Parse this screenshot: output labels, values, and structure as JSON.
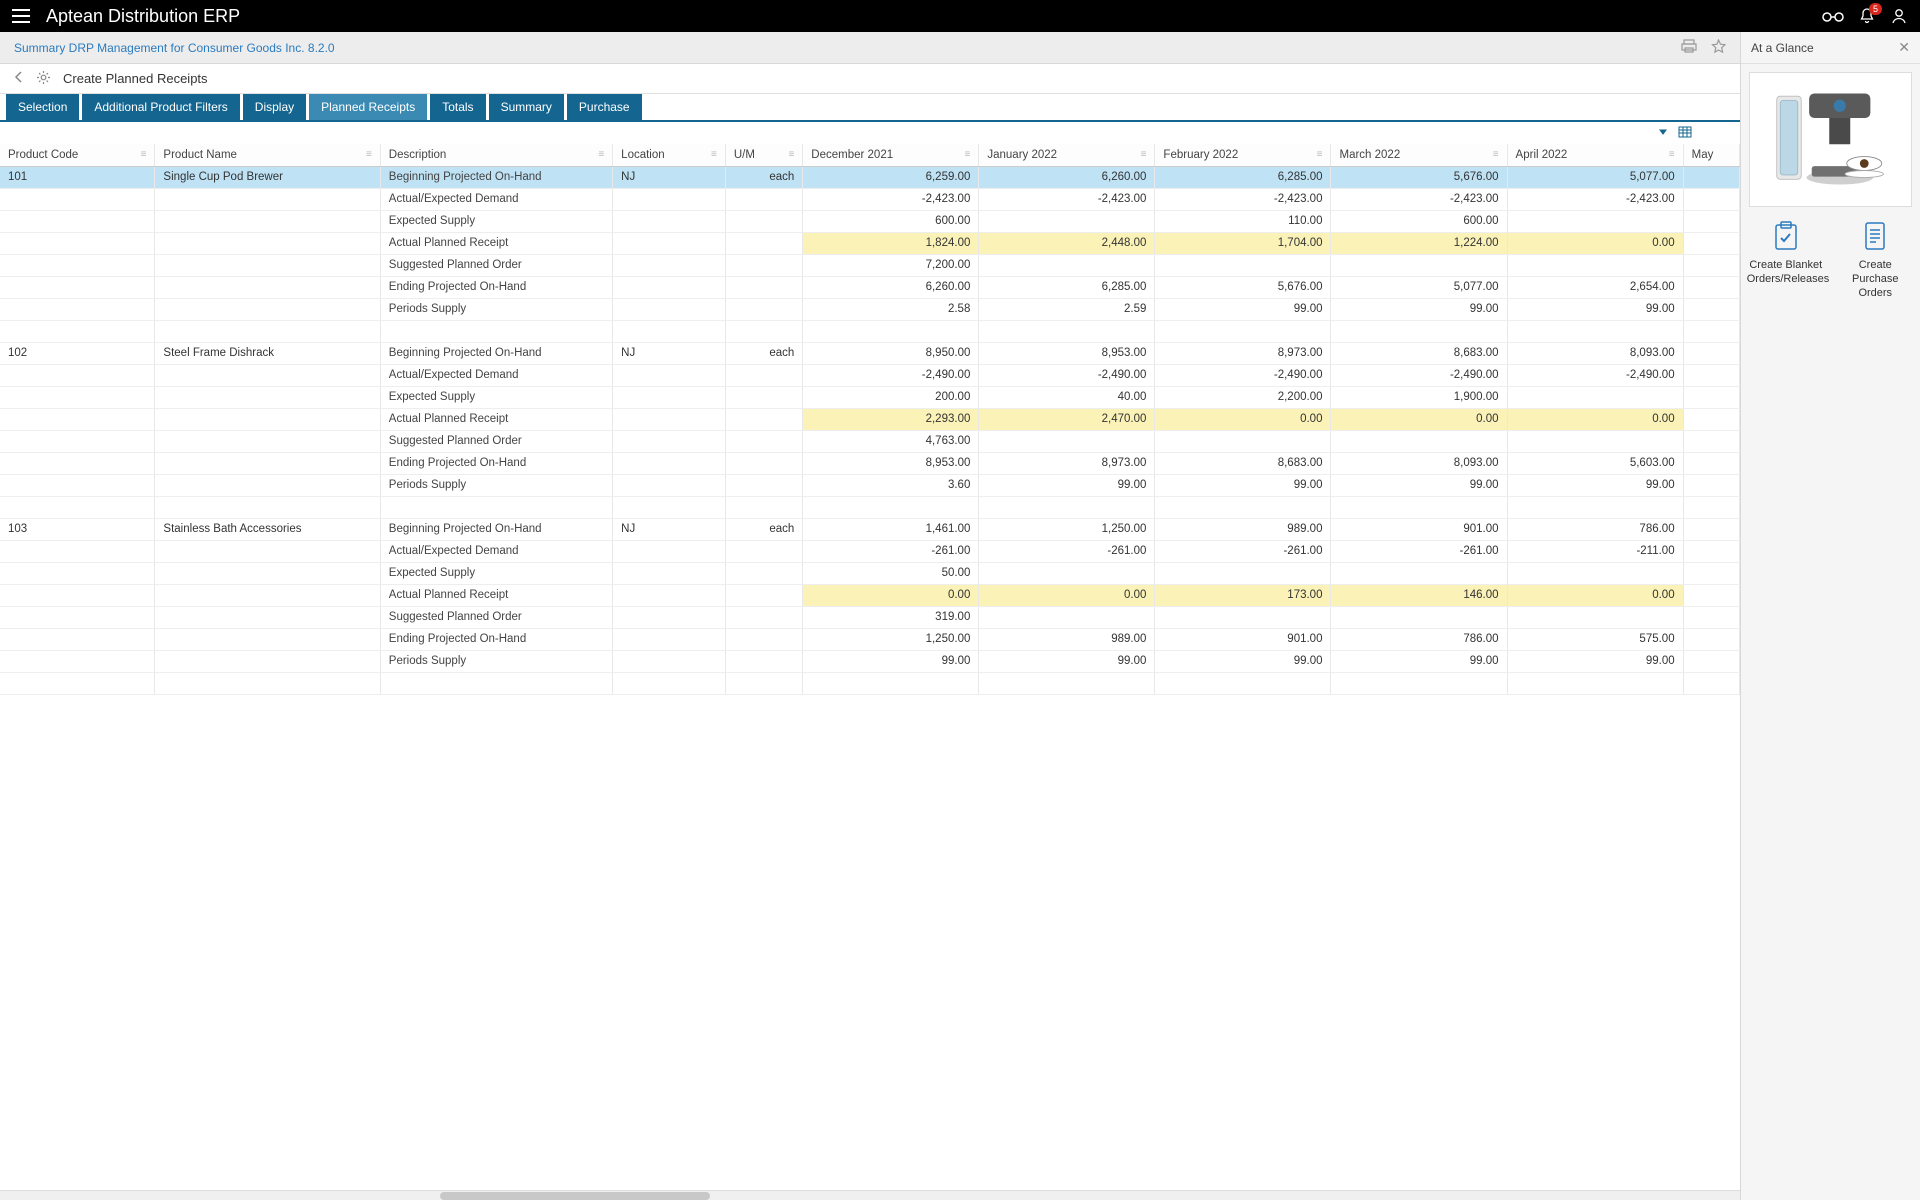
{
  "app": {
    "brand": "Aptean Distribution ERP"
  },
  "notifications": {
    "count": "5"
  },
  "breadcrumb": "Summary DRP Management for Consumer Goods Inc. 8.2.0",
  "page_title": "Create Planned Receipts",
  "tabs": [
    "Selection",
    "Additional Product Filters",
    "Display",
    "Planned Receipts",
    "Totals",
    "Summary",
    "Purchase"
  ],
  "active_tab_index": 3,
  "glance": {
    "title": "At a Glance",
    "actions": [
      {
        "label": "Create Blanket Orders/Releases"
      },
      {
        "label": "Create Purchase Orders"
      }
    ]
  },
  "columns": {
    "code": "Product Code",
    "name": "Product Name",
    "desc": "Description",
    "loc": "Location",
    "um": "U/M",
    "months": [
      "December 2021",
      "January 2022",
      "February 2022",
      "March 2022",
      "April 2022"
    ],
    "may_stub": "May"
  },
  "row_labels": {
    "bpo": "Beginning Projected On-Hand",
    "aed": "Actual/Expected Demand",
    "es": "Expected Supply",
    "apr": "Actual Planned Receipt",
    "spo": "Suggested Planned Order",
    "epo": "Ending Projected On-Hand",
    "ps": "Periods Supply"
  },
  "products": [
    {
      "code": "101",
      "name": "Single Cup Pod Brewer",
      "loc": "NJ",
      "um": "each",
      "rows": {
        "bpo": [
          "6,259.00",
          "6,260.00",
          "6,285.00",
          "5,676.00",
          "5,077.00"
        ],
        "aed": [
          "-2,423.00",
          "-2,423.00",
          "-2,423.00",
          "-2,423.00",
          "-2,423.00"
        ],
        "es": [
          "600.00",
          "",
          "110.00",
          "600.00",
          ""
        ],
        "apr": [
          "1,824.00",
          "2,448.00",
          "1,704.00",
          "1,224.00",
          "0.00"
        ],
        "spo": [
          "7,200.00",
          "",
          "",
          "",
          ""
        ],
        "epo": [
          "6,260.00",
          "6,285.00",
          "5,676.00",
          "5,077.00",
          "2,654.00"
        ],
        "ps": [
          "2.58",
          "2.59",
          "99.00",
          "99.00",
          "99.00"
        ]
      }
    },
    {
      "code": "102",
      "name": "Steel Frame Dishrack",
      "loc": "NJ",
      "um": "each",
      "rows": {
        "bpo": [
          "8,950.00",
          "8,953.00",
          "8,973.00",
          "8,683.00",
          "8,093.00"
        ],
        "aed": [
          "-2,490.00",
          "-2,490.00",
          "-2,490.00",
          "-2,490.00",
          "-2,490.00"
        ],
        "es": [
          "200.00",
          "40.00",
          "2,200.00",
          "1,900.00",
          ""
        ],
        "apr": [
          "2,293.00",
          "2,470.00",
          "0.00",
          "0.00",
          "0.00"
        ],
        "spo": [
          "4,763.00",
          "",
          "",
          "",
          ""
        ],
        "epo": [
          "8,953.00",
          "8,973.00",
          "8,683.00",
          "8,093.00",
          "5,603.00"
        ],
        "ps": [
          "3.60",
          "99.00",
          "99.00",
          "99.00",
          "99.00"
        ]
      }
    },
    {
      "code": "103",
      "name": "Stainless Bath Accessories",
      "loc": "NJ",
      "um": "each",
      "rows": {
        "bpo": [
          "1,461.00",
          "1,250.00",
          "989.00",
          "901.00",
          "786.00"
        ],
        "aed": [
          "-261.00",
          "-261.00",
          "-261.00",
          "-261.00",
          "-211.00"
        ],
        "es": [
          "50.00",
          "",
          "",
          "",
          ""
        ],
        "apr": [
          "0.00",
          "0.00",
          "173.00",
          "146.00",
          "0.00"
        ],
        "spo": [
          "319.00",
          "",
          "",
          "",
          ""
        ],
        "epo": [
          "1,250.00",
          "989.00",
          "901.00",
          "786.00",
          "575.00"
        ],
        "ps": [
          "99.00",
          "99.00",
          "99.00",
          "99.00",
          "99.00"
        ]
      }
    }
  ]
}
